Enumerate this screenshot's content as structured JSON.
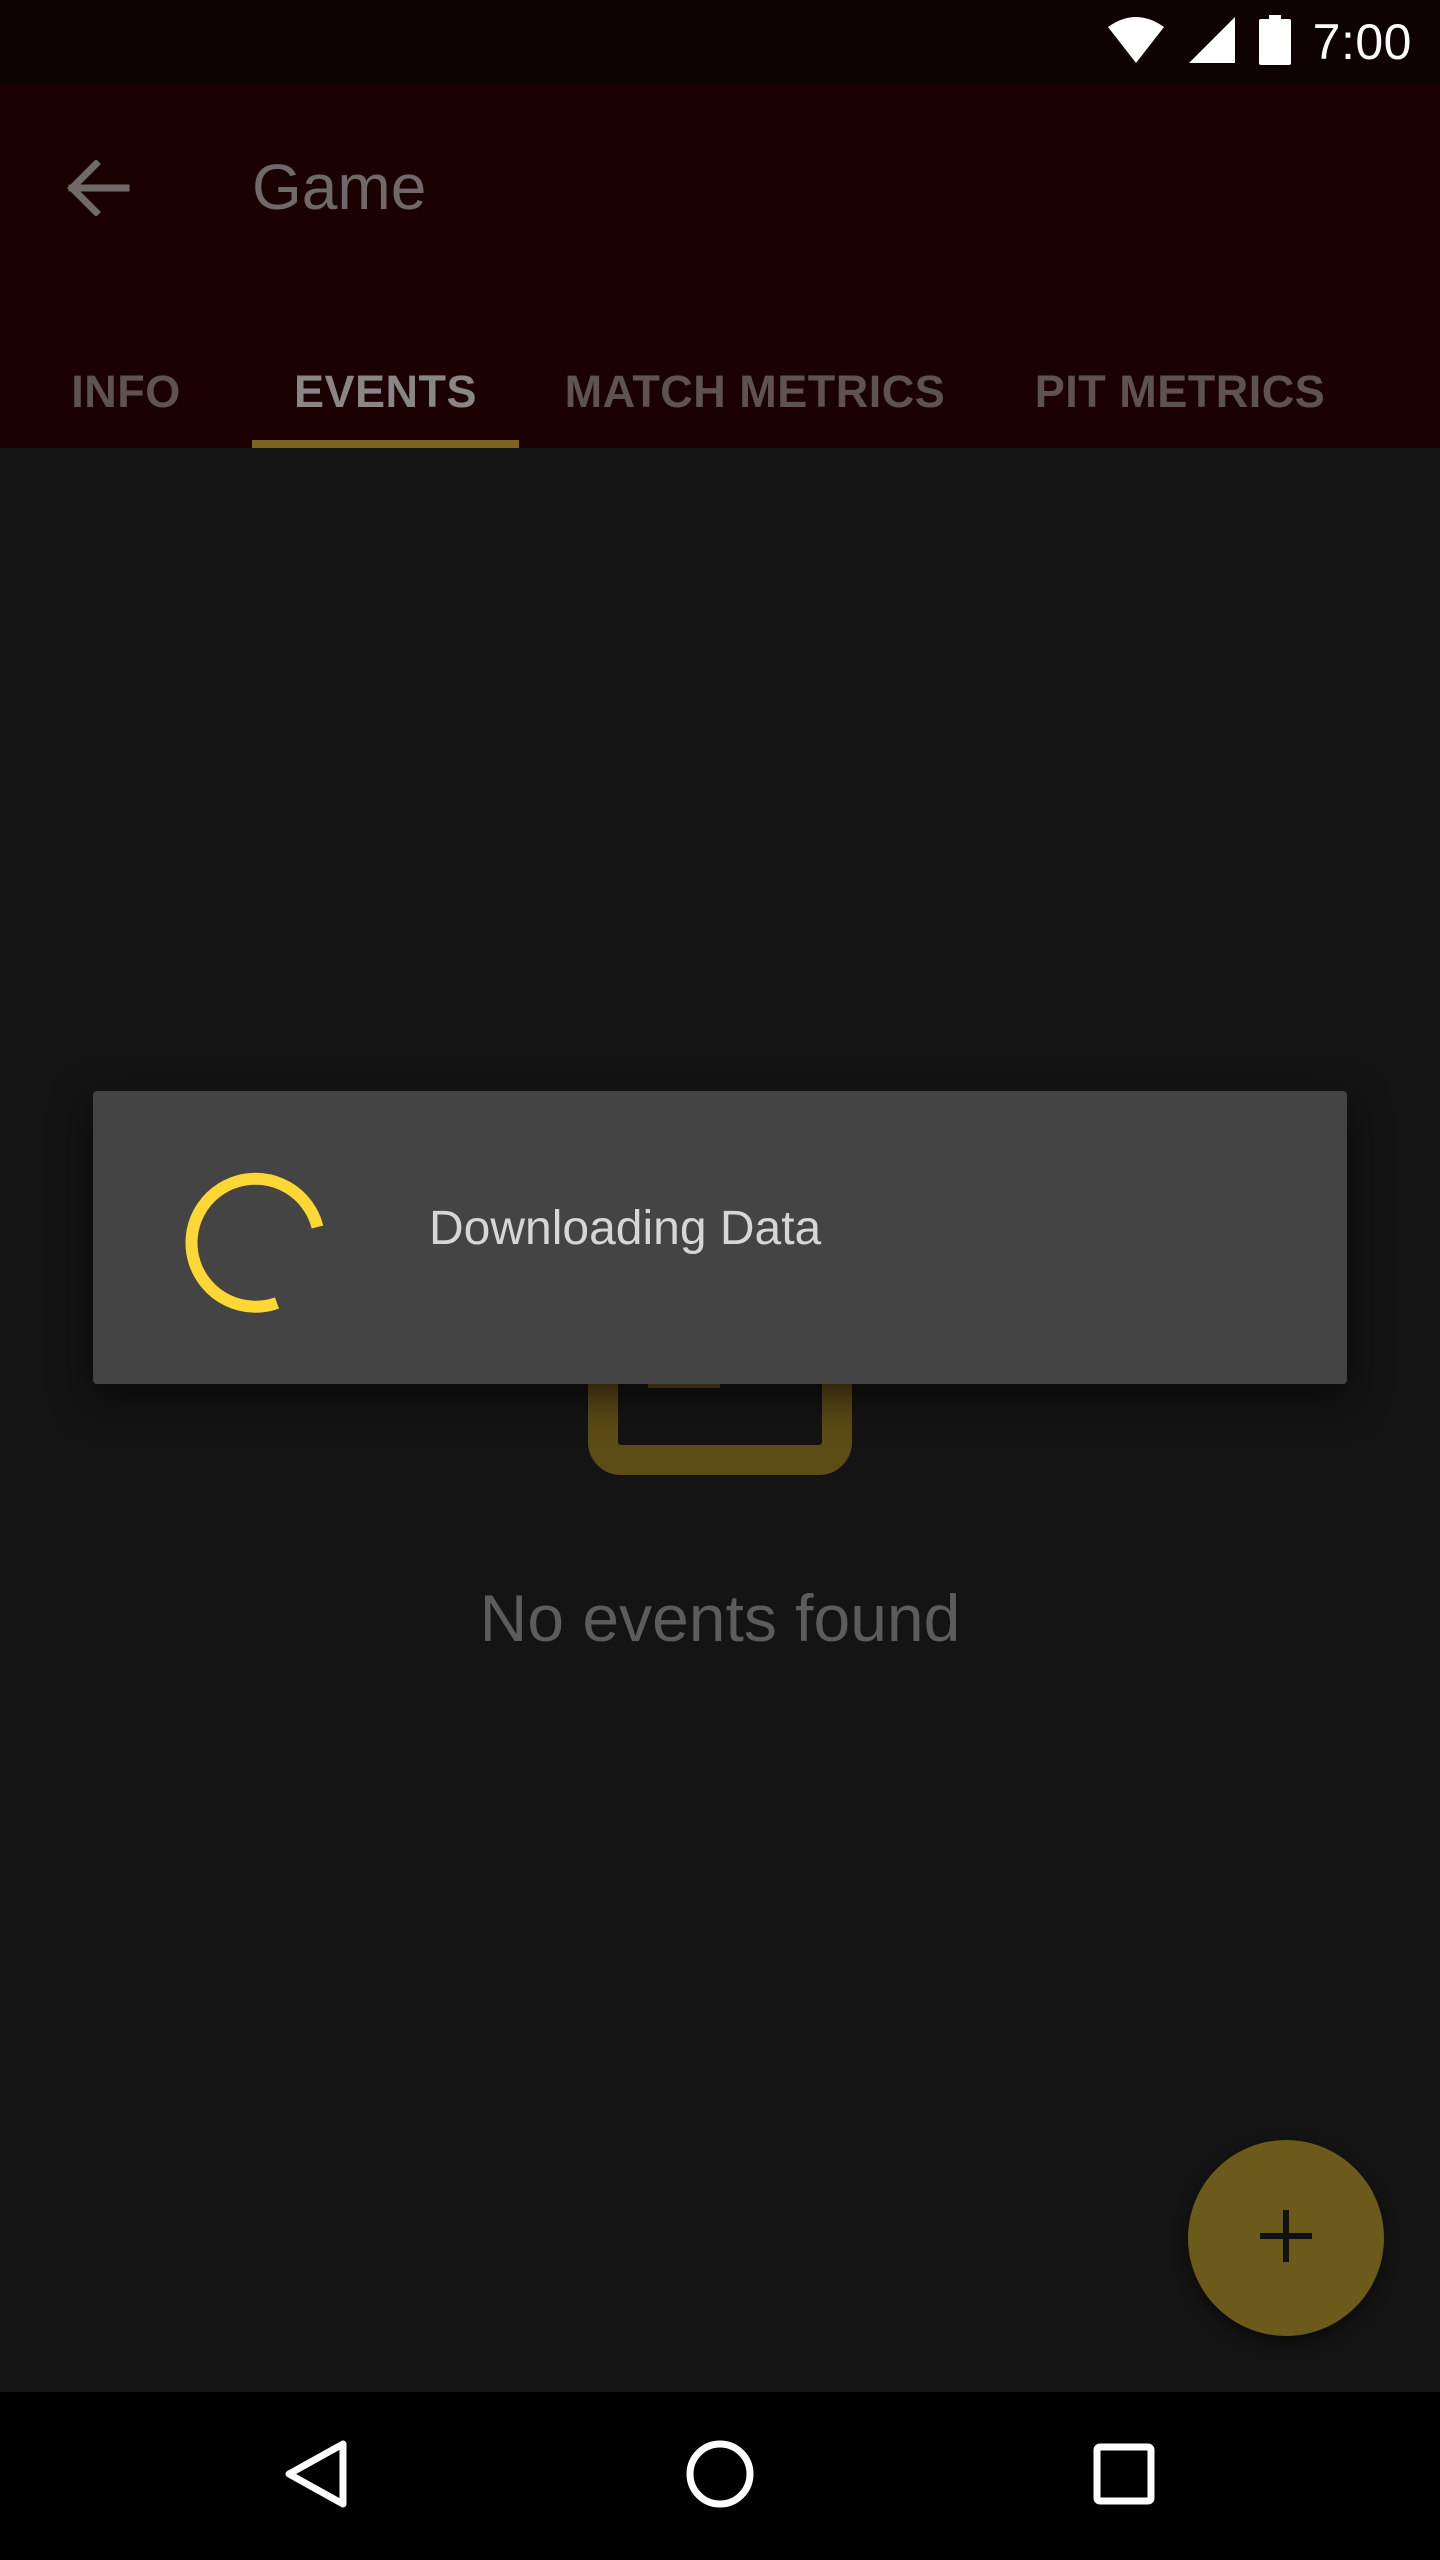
{
  "status_bar": {
    "time": "7:00",
    "icons": [
      "wifi-icon",
      "cell-signal-icon",
      "battery-icon"
    ]
  },
  "app_bar": {
    "back_icon": "arrow-back-icon",
    "title": "Game"
  },
  "tabs": [
    {
      "label": "INFO",
      "active": false
    },
    {
      "label": "EVENTS",
      "active": true
    },
    {
      "label": "MATCH METRICS",
      "active": false
    },
    {
      "label": "PIT METRICS",
      "active": false
    }
  ],
  "empty_state": {
    "icon": "calendar-icon",
    "message": "No events found"
  },
  "fab": {
    "icon": "plus-icon"
  },
  "dialog": {
    "message": "Downloading Data",
    "spinner_icon": "progress-spinner-icon"
  },
  "nav_bar": {
    "icons": [
      "back-triangle-icon",
      "home-circle-icon",
      "recents-square-icon"
    ]
  },
  "colors": {
    "app_bar": "#1c0103",
    "status_bar": "#0e0203",
    "content_bg": "#141414",
    "accent": "#fdd835",
    "accent_dimmed": "#6b5a1a",
    "dialog_bg": "#444444"
  }
}
